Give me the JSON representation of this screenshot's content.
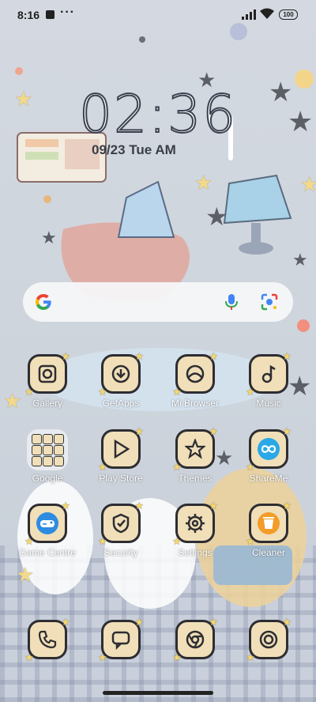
{
  "status_bar": {
    "time": "8:16",
    "dots": "···",
    "battery": "100"
  },
  "clock": {
    "time": "02:36",
    "date": "09/23 Tue AM"
  },
  "search": {
    "google_icon": "google-g-icon",
    "mic_icon": "mic-icon",
    "lens_icon": "lens-icon"
  },
  "apps": [
    {
      "label": "Gallery",
      "icon": "gallery-icon"
    },
    {
      "label": "GetApps",
      "icon": "download-icon"
    },
    {
      "label": "Mi Browser",
      "icon": "browser-icon"
    },
    {
      "label": "Music",
      "icon": "music-note-icon"
    },
    {
      "label": "Google",
      "icon": "folder-icon"
    },
    {
      "label": "Play Store",
      "icon": "play-icon"
    },
    {
      "label": "Themes",
      "icon": "star-icon"
    },
    {
      "label": "ShareMe",
      "icon": "infinity-icon"
    },
    {
      "label": "Game Centre",
      "icon": "gamepad-icon"
    },
    {
      "label": "Security",
      "icon": "shield-icon"
    },
    {
      "label": "Settings",
      "icon": "gear-icon"
    },
    {
      "label": "Cleaner",
      "icon": "trash-icon"
    }
  ],
  "dock": [
    {
      "icon": "phone-icon"
    },
    {
      "icon": "chat-icon"
    },
    {
      "icon": "chrome-icon"
    },
    {
      "icon": "camera-icon"
    }
  ],
  "colors": {
    "tile": "#f0dfb8",
    "tile_border": "#2d2d32",
    "star_accent": "#f5d76e",
    "shareme": "#2aa8e8",
    "game": "#2d8ce0",
    "cleaner": "#f39c2a"
  }
}
